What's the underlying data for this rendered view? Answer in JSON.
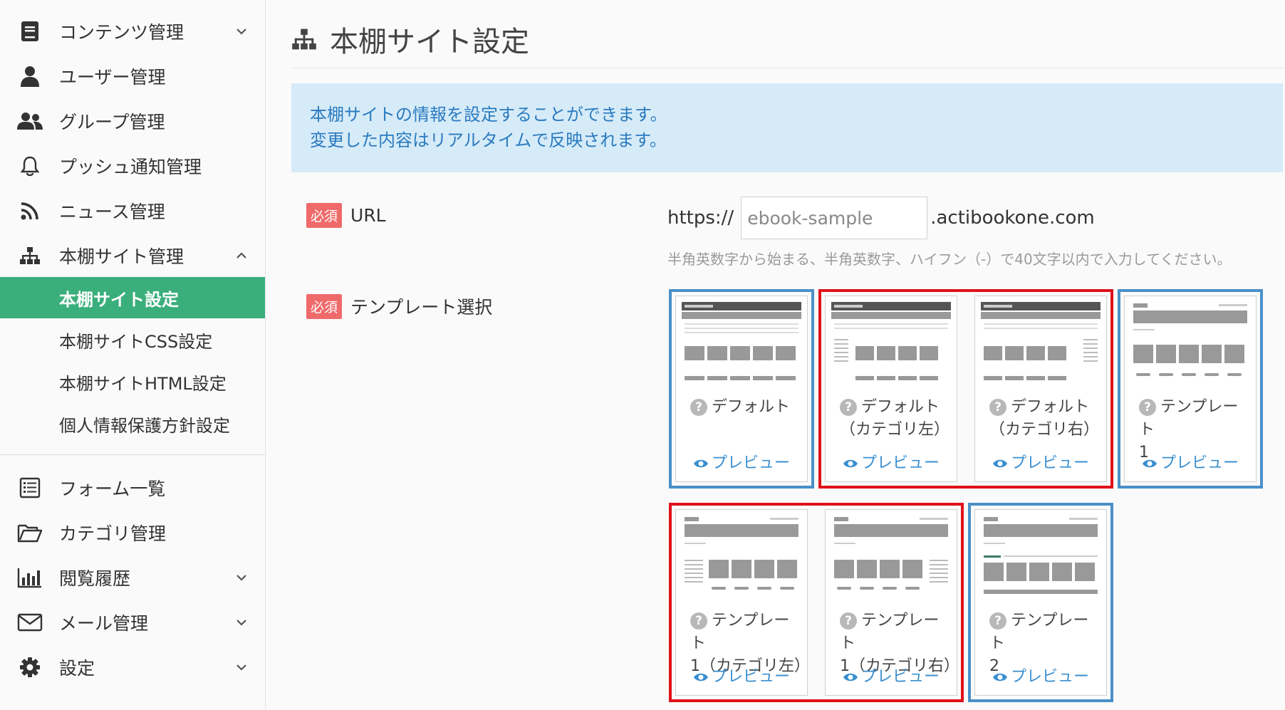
{
  "sidebar": {
    "items": [
      {
        "label": "コンテンツ管理",
        "icon": "document-icon",
        "has_chevron": true
      },
      {
        "label": "ユーザー管理",
        "icon": "user-icon",
        "has_chevron": false
      },
      {
        "label": "グループ管理",
        "icon": "users-icon",
        "has_chevron": false
      },
      {
        "label": "プッシュ通知管理",
        "icon": "bell-icon",
        "has_chevron": false
      },
      {
        "label": "ニュース管理",
        "icon": "rss-icon",
        "has_chevron": false
      },
      {
        "label": "本棚サイト管理",
        "icon": "sitemap-icon",
        "has_chevron": true
      }
    ],
    "sub_items": [
      {
        "label": "本棚サイト設定",
        "active": true
      },
      {
        "label": "本棚サイトCSS設定",
        "active": false
      },
      {
        "label": "本棚サイトHTML設定",
        "active": false
      },
      {
        "label": "個人情報保護方針設定",
        "active": false
      }
    ],
    "lower_items": [
      {
        "label": "フォーム一覧",
        "icon": "form-list-icon",
        "has_chevron": false
      },
      {
        "label": "カテゴリ管理",
        "icon": "folder-icon",
        "has_chevron": false
      },
      {
        "label": "閲覧履歴",
        "icon": "bar-chart-icon",
        "has_chevron": true
      },
      {
        "label": "メール管理",
        "icon": "mail-icon",
        "has_chevron": true
      },
      {
        "label": "設定",
        "icon": "gear-icon",
        "has_chevron": true
      }
    ]
  },
  "page": {
    "title": "本棚サイト設定",
    "info": [
      "本棚サイトの情報を設定することができます。",
      "変更した内容はリアルタイムで反映されます。"
    ],
    "required_badge": "必須",
    "url_label": "URL",
    "url_prefix": "https://",
    "url_value": "ebook-sample",
    "url_suffix": ".actibookone.com",
    "url_hint": "半角英数字から始まる、半角英数字、ハイフン（-）で40文字以内で入力してください。",
    "template_label": "テンプレート選択",
    "preview_label": "プレビュー",
    "templates": [
      {
        "line1": "デフォルト",
        "line2": ""
      },
      {
        "line1": "デフォルト",
        "line2": "（カテゴリ左）"
      },
      {
        "line1": "デフォルト",
        "line2": "（カテゴリ右）"
      },
      {
        "line1": "テンプレート",
        "line2": "1"
      },
      {
        "line1": "テンプレート",
        "line2": "1（カテゴリ左）"
      },
      {
        "line1": "テンプレート",
        "line2": "1（カテゴリ右）"
      },
      {
        "line1": "テンプレート",
        "line2": "2"
      }
    ]
  },
  "colors": {
    "active": "#3aaf7c",
    "info_bg": "#d6ebf8",
    "info_text": "#2a7bbf",
    "required": "#ef6a6a",
    "select_blue": "#4a90c8",
    "select_red": "#e0111b",
    "link": "#3a8fd0"
  }
}
